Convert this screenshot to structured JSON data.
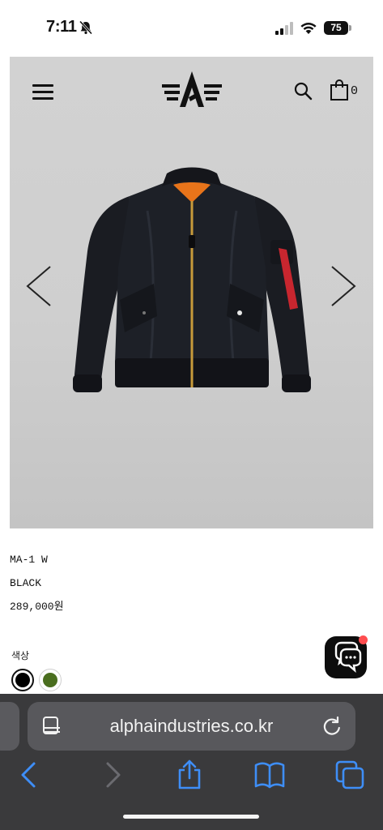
{
  "status_bar": {
    "time": "7:11",
    "battery": "75"
  },
  "header": {
    "cart_count": "0"
  },
  "product": {
    "name": "MA-1 W",
    "color": "BLACK",
    "price": "289,000원",
    "color_label": "색상",
    "swatches": [
      {
        "name": "black",
        "color": "#000000",
        "selected": true
      },
      {
        "name": "olive",
        "color": "#4a6e1f",
        "selected": false
      }
    ]
  },
  "browser": {
    "url": "alphaindustries.co.kr"
  }
}
